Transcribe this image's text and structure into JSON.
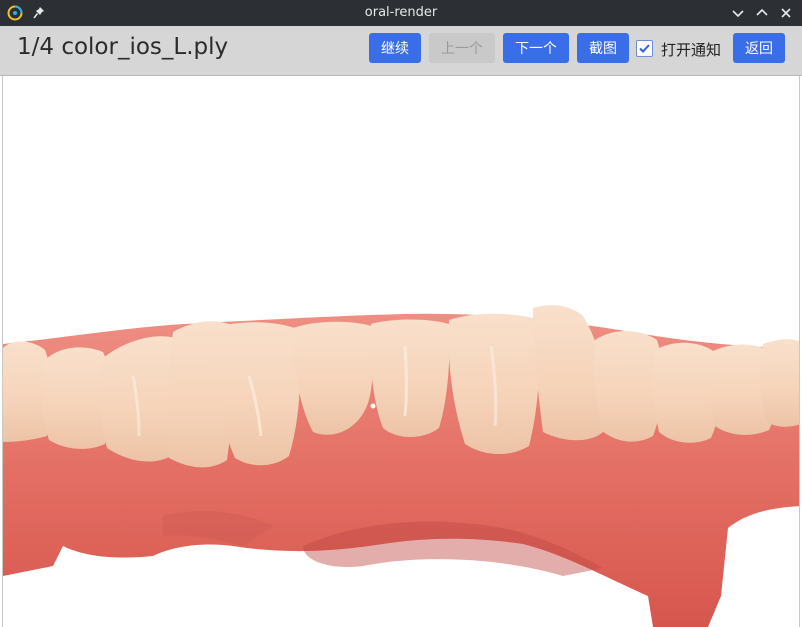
{
  "window": {
    "title": "oral-render",
    "icons": [
      "app-icon",
      "pin-icon",
      "minimize-icon",
      "maximize-icon",
      "close-icon"
    ]
  },
  "toolbar": {
    "file_title": "1/4 color_ios_L.ply",
    "continue_label": "继续",
    "prev_label": "上一个",
    "next_label": "下一个",
    "screenshot_label": "截图",
    "notify_label": "打开通知",
    "notify_checked": true,
    "back_label": "返回"
  },
  "viewport": {
    "content": "3d-dental-model-render"
  },
  "colors": {
    "accent": "#3a6ee8",
    "titlebar": "#2c2f33",
    "toolbar": "#d6d6d6",
    "teeth": "#f4d2b8",
    "gum": "#e7776c"
  }
}
